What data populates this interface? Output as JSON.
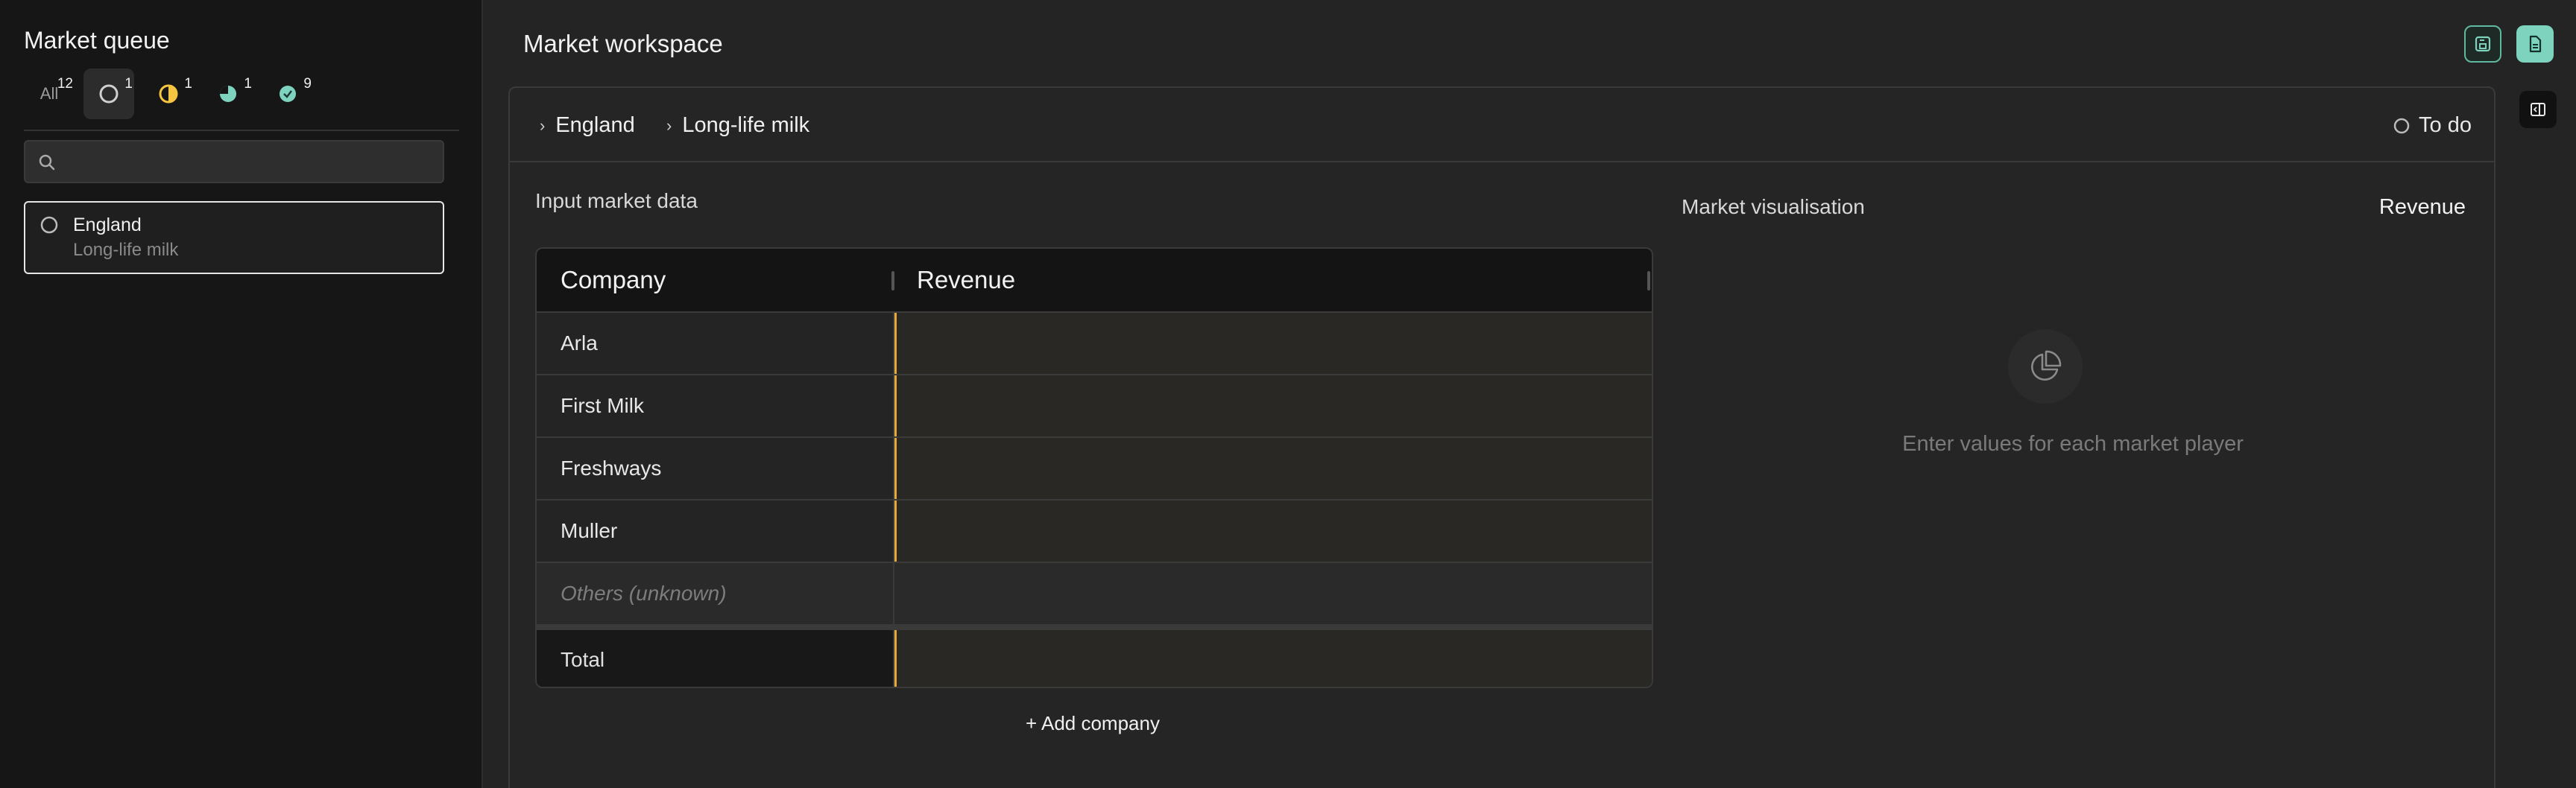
{
  "sidebar": {
    "title": "Market queue",
    "filters": [
      {
        "label": "All",
        "count": "12"
      },
      {
        "icon": "empty-circle-icon",
        "count": "1"
      },
      {
        "icon": "half-circle-icon",
        "count": "1"
      },
      {
        "icon": "pie-circle-icon",
        "count": "1"
      },
      {
        "icon": "check-circle-icon",
        "count": "9"
      }
    ],
    "search": {
      "placeholder": "",
      "value": ""
    },
    "items": [
      {
        "title": "England",
        "subtitle": "Long-life milk"
      }
    ]
  },
  "workspace": {
    "title": "Market workspace",
    "breadcrumbs": [
      "England",
      "Long-life milk"
    ],
    "status": "To do",
    "input_label": "Input market data",
    "table": {
      "headers": [
        "Company",
        "Revenue"
      ],
      "rows": [
        "Arla",
        "First Milk",
        "Freshways",
        "Muller"
      ],
      "others": "Others (unknown)",
      "total": "Total"
    },
    "add_company": "+ Add company",
    "viz": {
      "label": "Market visualisation",
      "metric": "Revenue",
      "empty": "Enter values for each market player"
    }
  },
  "colors": {
    "accent": "#7dd3bd",
    "highlight": "#e6a93a",
    "pending": "#f5c542"
  }
}
